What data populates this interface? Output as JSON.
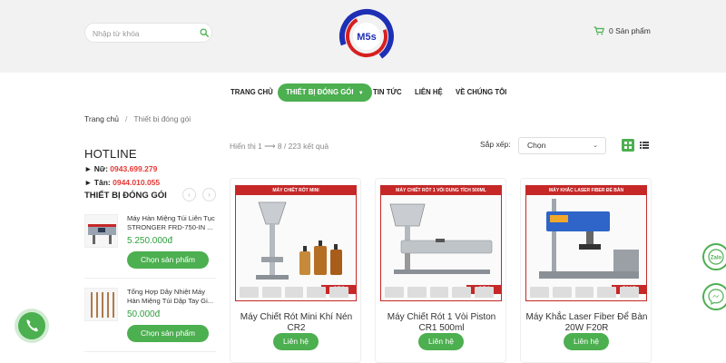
{
  "header": {
    "search_placeholder": "Nhập từ khóa",
    "logo_text": "M5s",
    "cart_label": "0 Sản phẩm"
  },
  "nav": {
    "items": [
      "TRANG CHỦ",
      "THIẾT BỊ ĐÓNG GÓI",
      "TIN TỨC",
      "LIÊN HỆ",
      "VỀ CHÚNG TÔI"
    ],
    "active_index": 1
  },
  "breadcrumb": {
    "home": "Trang chủ",
    "separator": "/",
    "current": "Thiết bị đóng gói"
  },
  "sidebar": {
    "hotline_title": "HOTLINE",
    "hotlines": [
      {
        "label": "Nữ:",
        "number": "0943.699.279"
      },
      {
        "label": "Tân:",
        "number": "0944.010.055"
      }
    ],
    "category_title": "THIẾT BỊ ĐÓNG GÓI",
    "products": [
      {
        "name": "Máy Hàn Miệng Túi Liên Tục STRONGER FRD-750-IN ...",
        "price": "5.250.000đ",
        "button": "Chọn sản phẩm"
      },
      {
        "name": "Tổng Hợp Dây Nhiệt Máy Hàn Miệng Túi Dập Tay Gi...",
        "price": "50.000đ",
        "button": "Chọn sản phẩm"
      }
    ]
  },
  "listing": {
    "result_text": "Hiển thị 1 ⟶ 8 / 223 kết quả",
    "sort_label": "Sắp xếp:",
    "sort_value": "Chọn"
  },
  "products": [
    {
      "banner": "MÁY CHIẾT RÓT MINI",
      "model": "CR2",
      "title": "Máy Chiết Rót Mini Khí Nén CR2",
      "button": "Liên hệ"
    },
    {
      "banner": "MÁY CHIẾT RÓT 1 VÒI DUNG TÍCH 500ML",
      "model": "CR1",
      "title": "Máy Chiết Rót 1 Vòi Piston CR1 500ml",
      "button": "Liên hệ"
    },
    {
      "banner": "MÁY KHẮC LASER FIBER ĐỂ BÀN",
      "model": "F20R",
      "title": "Máy Khắc Laser Fiber Để Bàn 20W F20R",
      "button": "Liên hệ"
    }
  ],
  "floating": {
    "zalo_label": "Zalo"
  },
  "colors": {
    "accent": "#4caf50",
    "price": "#2e9e3e",
    "hotline_number": "#e53935",
    "banner_red": "#c62828",
    "logo_blue": "#1e2fb5",
    "logo_red": "#d62020"
  },
  "icons": {
    "search": "search-icon",
    "cart": "cart-icon",
    "grid": "grid-view-icon",
    "list": "list-view-icon",
    "phone": "phone-icon",
    "zalo": "zalo-icon",
    "messenger": "messenger-icon"
  }
}
